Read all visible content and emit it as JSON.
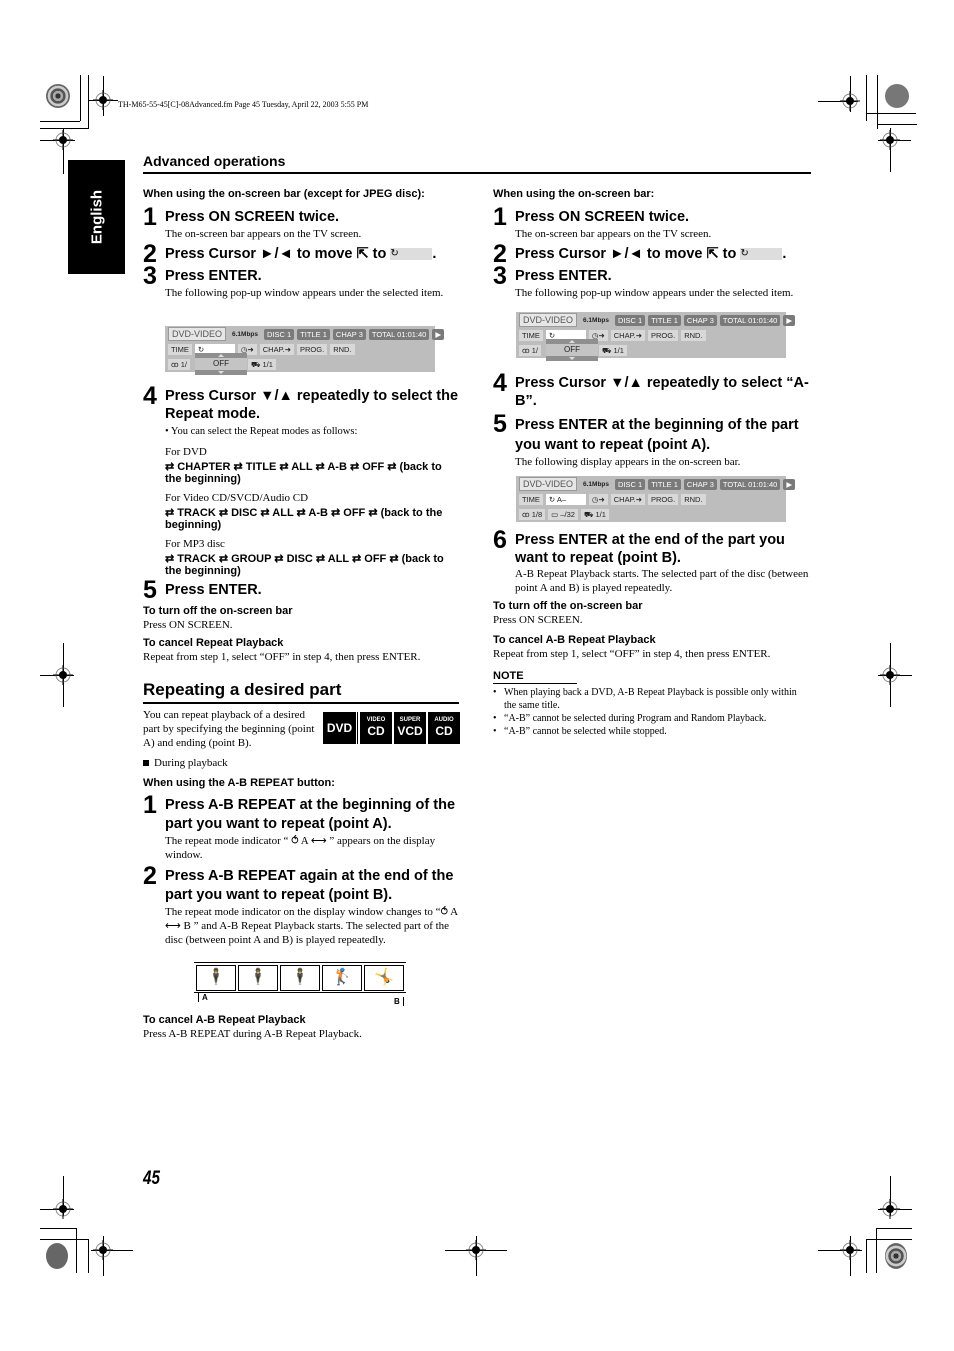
{
  "header": {
    "file_line": "TH-M65-55-45[C]-08Advanced.fm  Page 45  Tuesday, April 22, 2003  5:55 PM"
  },
  "language_tab": "English",
  "section_title": "Advanced operations",
  "left_column": {
    "subhead": "When using the on-screen bar (except for JPEG disc):",
    "steps": [
      {
        "num": "1",
        "title": "Press ON SCREEN twice.",
        "body": "The on-screen bar appears on the TV screen."
      },
      {
        "num": "2",
        "title": "Press Cursor ►/◄ to move ⇱ to",
        "suffix": "."
      },
      {
        "num": "3",
        "title": "Press ENTER.",
        "body": "The following pop-up window appears under the selected item."
      },
      {
        "num": "4",
        "title": "Press Cursor ▼/▲ repeatedly to select the Repeat mode.",
        "bullet": "You can select the Repeat modes as follows:"
      },
      {
        "num": "5",
        "title": "Press ENTER."
      }
    ],
    "repeat_modes": [
      {
        "label": "For DVD",
        "sequence": "⇄ CHAPTER ⇄ TITLE ⇄ ALL ⇄ A-B ⇄ OFF ⇄ (back to the beginning)"
      },
      {
        "label": "For Video CD/SVCD/Audio CD",
        "sequence": "⇄ TRACK ⇄ DISC ⇄ ALL ⇄ A-B ⇄ OFF ⇄ (back to the beginning)"
      },
      {
        "label": "For MP3 disc",
        "sequence": "⇄ TRACK ⇄ GROUP ⇄ DISC ⇄ ALL ⇄ OFF ⇄ (back to the beginning)"
      }
    ],
    "turn_off": {
      "label": "To turn off the on-screen bar",
      "text": "Press ON SCREEN."
    },
    "cancel": {
      "label": "To cancel Repeat Playback",
      "text": "Repeat from step 1, select “OFF” in step 4, then press ENTER."
    },
    "repeating_part": {
      "title": "Repeating a desired part",
      "intro": "You can repeat playback of a desired part by specifying the beginning (point A) and ending (point B).",
      "badges": [
        {
          "small": "",
          "large": "DVD"
        },
        {
          "small": "VIDEO",
          "large": "CD"
        },
        {
          "small": "SUPER",
          "large": "VCD"
        },
        {
          "small": "AUDIO",
          "large": "CD"
        }
      ],
      "during": "During playback",
      "subhead": "When using the A-B REPEAT button:",
      "steps": [
        {
          "num": "1",
          "title": "Press A-B REPEAT at the beginning of the part you want to repeat (point A).",
          "body": "The repeat mode indicator “ ⥀ A ⟷ ” appears on the display window."
        },
        {
          "num": "2",
          "title": "Press A-B REPEAT again at the end of the part you want to repeat (point B).",
          "body": "The repeat mode indicator on the display window changes to “⥀ A ⟷ B ” and A-B Repeat Playback starts. The selected part of the disc (between point A and B) is played repeatedly."
        }
      ],
      "frames_label_a": "A",
      "frames_label_b": "B",
      "cancel": {
        "label": "To cancel A-B Repeat Playback",
        "text": "Press A-B REPEAT during A-B Repeat Playback."
      }
    }
  },
  "right_column": {
    "subhead": "When using the on-screen bar:",
    "steps": [
      {
        "num": "1",
        "title": "Press ON SCREEN twice.",
        "body": "The on-screen bar appears on the TV screen."
      },
      {
        "num": "2",
        "title": "Press Cursor ►/◄ to move ⇱ to",
        "suffix": "."
      },
      {
        "num": "3",
        "title": "Press ENTER.",
        "body": "The following pop-up window appears under the selected item."
      },
      {
        "num": "4",
        "title": "Press Cursor ▼/▲ repeatedly to select “A-B”."
      },
      {
        "num": "5",
        "title": "Press ENTER at the beginning of the part you want to repeat (point A).",
        "body": "The following display appears in the on-screen bar."
      },
      {
        "num": "6",
        "title": "Press ENTER at the end of the part you want to repeat (point B).",
        "body": "A-B Repeat Playback starts. The selected part of the disc (between point A and B) is played repeatedly."
      }
    ],
    "turn_off": {
      "label": "To turn off the on-screen bar",
      "text": "Press ON SCREEN."
    },
    "cancel": {
      "label": "To cancel A-B Repeat Playback",
      "text": "Repeat from step 1, select “OFF” in step 4, then press ENTER."
    },
    "note": {
      "title": "NOTE",
      "items": [
        "When playing back a DVD, A-B Repeat Playback is possible only within the same title.",
        "“A-B” cannot be selected during Program and Random Playback.",
        "“A-B” cannot be selected while stopped."
      ]
    }
  },
  "osd": {
    "source": "DVD-VIDEO",
    "bitrate": "6.1Mbps",
    "disc": "DISC 1",
    "title": "TITLE  1",
    "chap": "CHAP  3",
    "total": "TOTAL 01:01:40",
    "play_icon": "▶",
    "time": "TIME",
    "repeat_icon": "↻",
    "repeat_ab": "↻ A–",
    "clock": "◷➜",
    "chapter_jump": "CHAP.➜",
    "prog": "PROG.",
    "rnd": "RND.",
    "audio": "ꝏ 1/",
    "audio_full": "ꝏ 1/8",
    "subtitle": "▭ –/32",
    "angle": "🎥 1/1",
    "angle_short": "⛟ 1/1",
    "popup_value": "OFF"
  },
  "page_number": "45"
}
